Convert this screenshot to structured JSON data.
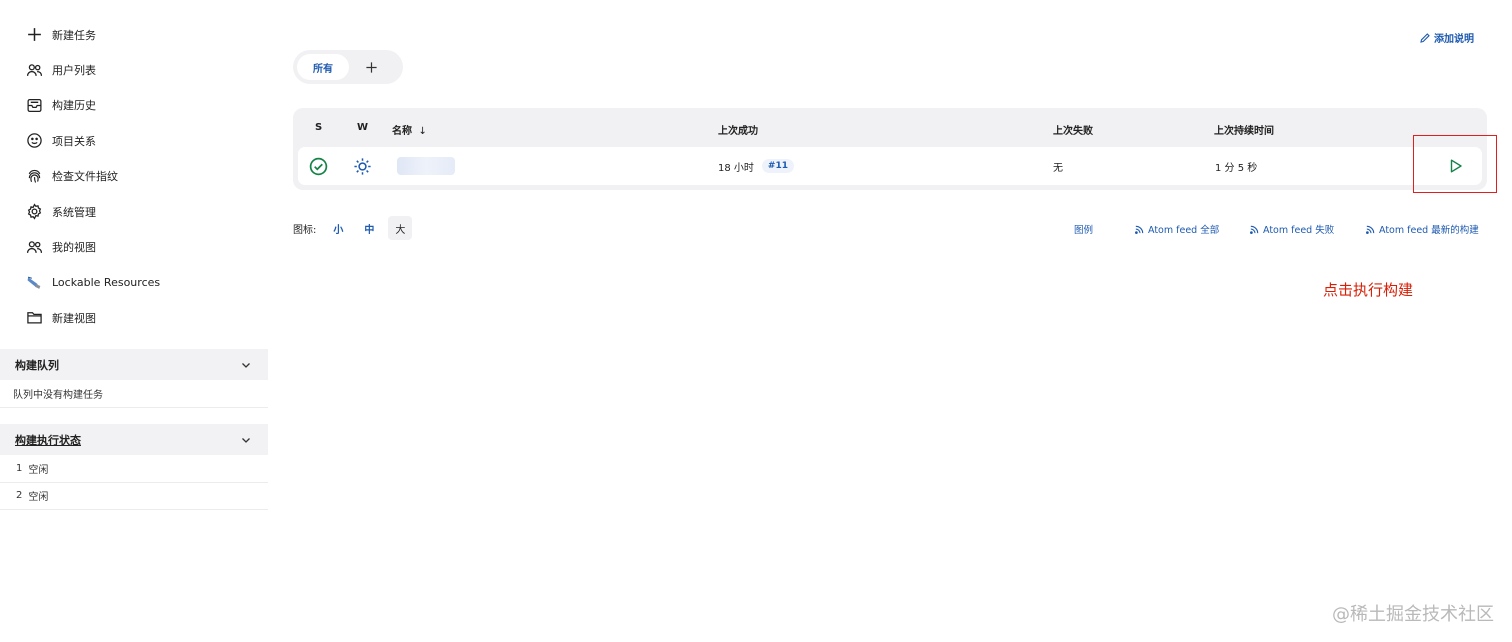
{
  "sidebar": {
    "items": [
      {
        "label": "新建任务",
        "icon": "plus-icon"
      },
      {
        "label": "用户列表",
        "icon": "users-icon"
      },
      {
        "label": "构建历史",
        "icon": "inbox-icon"
      },
      {
        "label": "项目关系",
        "icon": "smile-icon"
      },
      {
        "label": "检查文件指纹",
        "icon": "fingerprint-icon"
      },
      {
        "label": "系统管理",
        "icon": "gear-icon"
      },
      {
        "label": "我的视图",
        "icon": "users-icon"
      },
      {
        "label": "Lockable Resources",
        "icon": "lock-resource-icon"
      },
      {
        "label": "新建视图",
        "icon": "folder-icon"
      }
    ]
  },
  "build_queue": {
    "title": "构建队列",
    "empty_text": "队列中没有构建任务"
  },
  "executors": {
    "title": "构建执行状态",
    "rows": [
      {
        "num": "1",
        "status": "空闲"
      },
      {
        "num": "2",
        "status": "空闲"
      }
    ]
  },
  "header": {
    "add_description": "添加说明"
  },
  "tabs": {
    "active": "所有",
    "add_symbol": "+"
  },
  "table": {
    "headers": {
      "s": "S",
      "w": "W",
      "name": "名称",
      "sort_arrow": "↓",
      "last_success": "上次成功",
      "last_failure": "上次失败",
      "last_duration": "上次持续时间"
    },
    "rows": [
      {
        "status": "success",
        "weather": "sunny",
        "last_success": "18 小时",
        "build": "#11",
        "last_failure": "无",
        "last_duration": "1 分 5 秒"
      }
    ]
  },
  "icon_size": {
    "label": "图标:",
    "small": "小",
    "medium": "中",
    "large": "大",
    "selected": "large"
  },
  "feeds": {
    "legend": "图例",
    "all": "Atom feed 全部",
    "failures": "Atom feed 失败",
    "latest": "Atom feed 最新的构建"
  },
  "annotation": "点击执行构建",
  "watermark": "@稀土掘金技术社区",
  "colors": {
    "accent": "#1d5ab0",
    "success": "#138347",
    "annotation": "#d81e06"
  }
}
